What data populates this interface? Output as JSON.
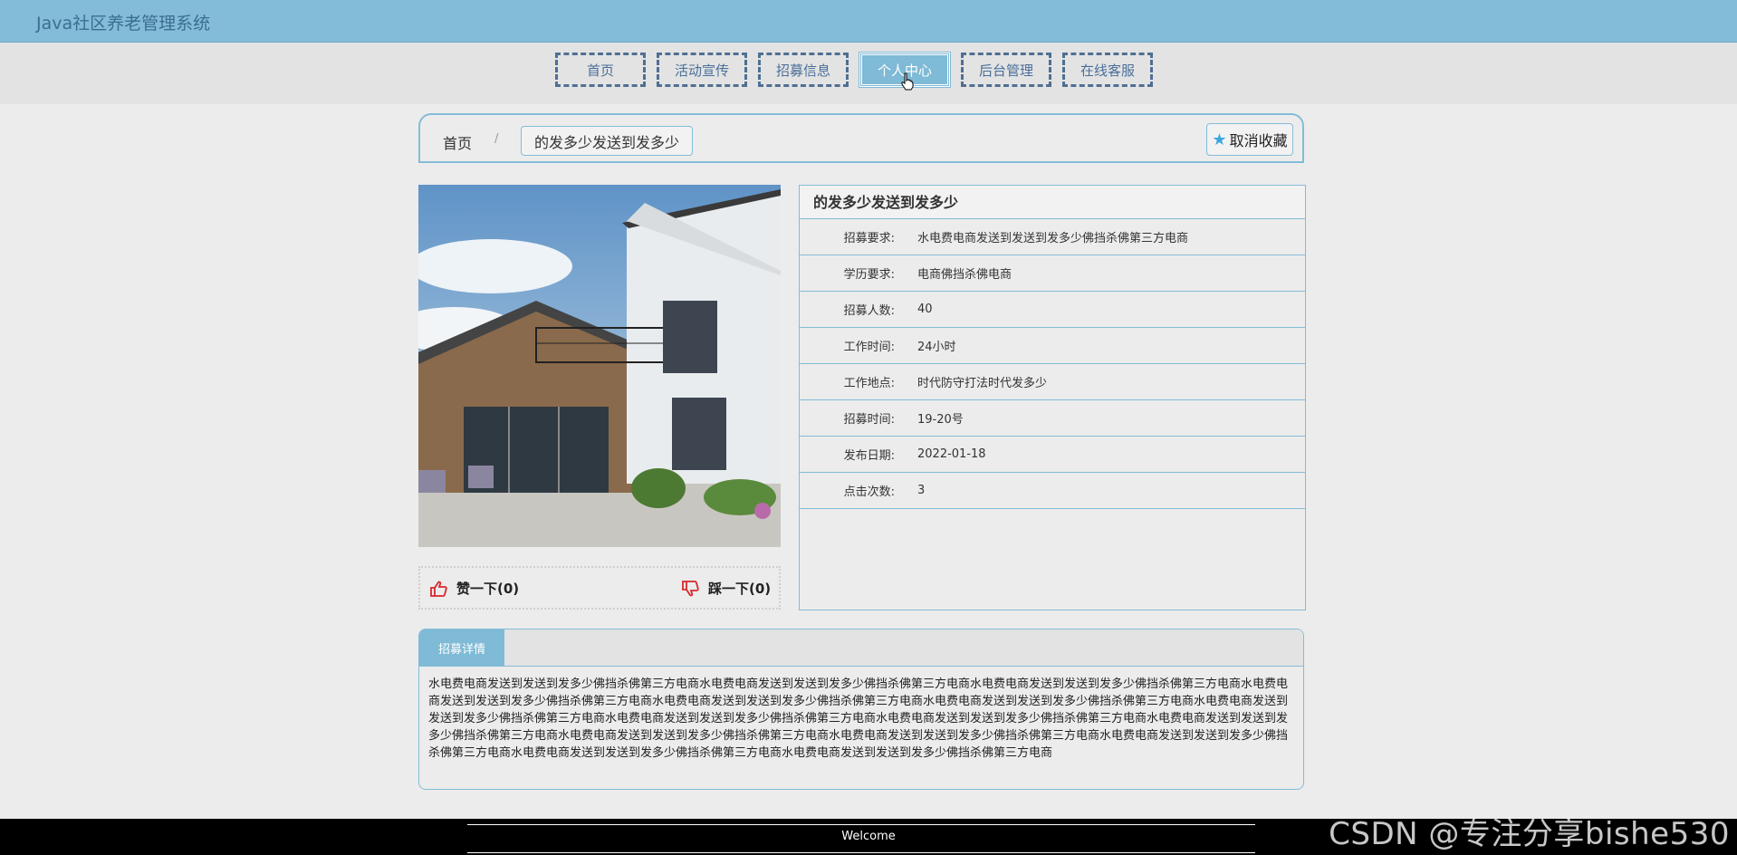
{
  "app": {
    "title": "Java社区养老管理系统"
  },
  "nav": {
    "items": [
      {
        "label": "首页"
      },
      {
        "label": "活动宣传"
      },
      {
        "label": "招募信息"
      },
      {
        "label": "个人中心"
      },
      {
        "label": "后台管理"
      },
      {
        "label": "在线客服"
      }
    ],
    "active_index": 3
  },
  "breadcrumb": {
    "home": "首页",
    "separator": "/",
    "current": "的发多少发送到发多少"
  },
  "favorite": {
    "label": "取消收藏",
    "icon": "star-icon"
  },
  "votes": {
    "like_label": "赞一下(0)",
    "dislike_label": "踩一下(0)"
  },
  "info": {
    "title": "的发多少发送到发多少",
    "rows": [
      {
        "label": "招募要求:",
        "value": "水电费电商发送到发送到发多少佛挡杀佛第三方电商"
      },
      {
        "label": "学历要求:",
        "value": "电商佛挡杀佛电商"
      },
      {
        "label": "招募人数:",
        "value": "40"
      },
      {
        "label": "工作时间:",
        "value": "24小时"
      },
      {
        "label": "工作地点:",
        "value": "时代防守打法时代发多少"
      },
      {
        "label": "招募时间:",
        "value": "19-20号"
      },
      {
        "label": "发布日期:",
        "value": "2022-01-18"
      },
      {
        "label": "点击次数:",
        "value": "3"
      }
    ]
  },
  "detail": {
    "tab_label": "招募详情",
    "text": "水电费电商发送到发送到发多少佛挡杀佛第三方电商水电费电商发送到发送到发多少佛挡杀佛第三方电商水电费电商发送到发送到发多少佛挡杀佛第三方电商水电费电商发送到发送到发多少佛挡杀佛第三方电商水电费电商发送到发送到发多少佛挡杀佛第三方电商水电费电商发送到发送到发多少佛挡杀佛第三方电商水电费电商发送到发送到发多少佛挡杀佛第三方电商水电费电商发送到发送到发多少佛挡杀佛第三方电商水电费电商发送到发送到发多少佛挡杀佛第三方电商水电费电商发送到发送到发多少佛挡杀佛第三方电商水电费电商发送到发送到发多少佛挡杀佛第三方电商水电费电商发送到发送到发多少佛挡杀佛第三方电商水电费电商发送到发送到发多少佛挡杀佛第三方电商水电费电商发送到发送到发多少佛挡杀佛第三方电商水电费电商发送到发送到发多少佛挡杀佛第三方电商"
  },
  "footer": {
    "text": "Welcome"
  },
  "watermark": {
    "text": "CSDN @专注分享bishe530"
  },
  "colors": {
    "accent": "#83bcd8",
    "nav_border": "#4f6f93",
    "footer": "#000000"
  }
}
